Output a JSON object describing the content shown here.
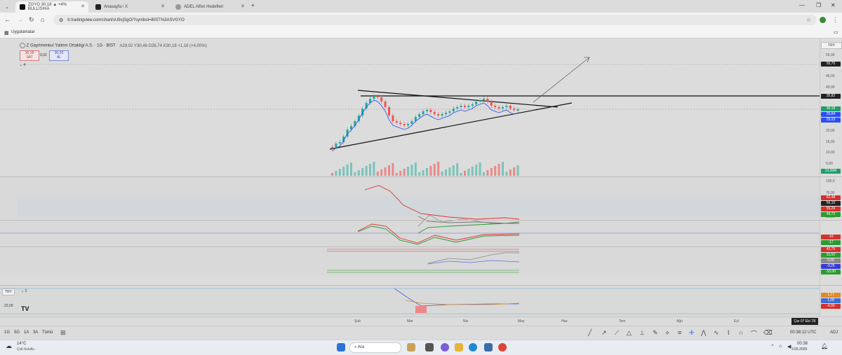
{
  "browser": {
    "tabs": [
      {
        "title": "ZGYO 30,18 ▲ +4% BULLISH/A"
      },
      {
        "title": "Anasayfa / X"
      },
      {
        "title": "ADEL Alfon Hedefleri"
      }
    ],
    "new_tab": "+",
    "window_controls": [
      "—",
      "❐",
      "✕"
    ],
    "url": "tr.tradingview.com/chart/sU9sjSgO/?symbol=BIST%3ASVGYO",
    "bookmarks_label": "Uygulamalar"
  },
  "chart": {
    "symbol_title": "Z Gayrimenkul Yatirim Ortakligi A.S. · 1G · BIST",
    "ohlc": "A29,02  Y30,46  D28,74  K30,18  +1,16 (+4,00%)",
    "sell_price": "30,18",
    "sell_label": "SAT",
    "spread": "0,02",
    "buy_price": "30,20",
    "buy_label": "AL",
    "collapse_count": "4",
    "currency": "TRY",
    "price_labels": [
      "55,00",
      "50,00",
      "45,00",
      "40,00",
      "35,00",
      "30,00",
      "25,00",
      "20,00",
      "15,00",
      "10,00",
      "5,00"
    ],
    "badges": {
      "target": "50,70",
      "resistance": "35,82",
      "symbol_tag": "ZGYO",
      "last": "30,18",
      "ma1": "29,84",
      "ma2": "29,03",
      "volume": "13,36M"
    },
    "rsi_labels": [
      "100,0",
      "75,00",
      "25,00"
    ],
    "rsi_badges": [
      "62,48",
      "56,10",
      "55,26",
      "49,72"
    ],
    "osc_badges": [
      "-16",
      "-17"
    ],
    "osc3_badges": [
      "42,75",
      "33,50",
      "0,00",
      "-9,25",
      "-53,00"
    ],
    "bottom_pane": {
      "currency": "TRY",
      "count": "2",
      "value": "22,00",
      "badges": [
        "1,17",
        "1,08",
        "-0,09"
      ]
    },
    "time_labels": [
      "Şub",
      "Mar",
      "Nis",
      "May",
      "Haz",
      "Tem",
      "Ağu",
      "Eyl"
    ],
    "cursor_date": "Çar 07 Eki '26"
  },
  "toolbar": {
    "timeframes": [
      "1G",
      "5G",
      "1A",
      "3A",
      "Tümü"
    ],
    "clock": "00:38:12 UTC",
    "adj": "ADJ"
  },
  "taskbar": {
    "weather_temp": "14°C",
    "weather_desc": "Çok bulutlu",
    "search_placeholder": "Ara",
    "time": "00:38",
    "date": "3.05.2026"
  }
}
